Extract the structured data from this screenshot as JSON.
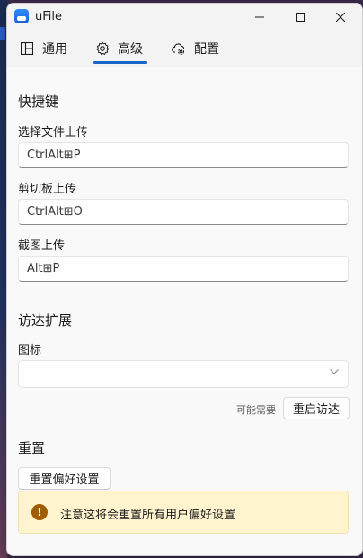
{
  "window": {
    "title": "uFile"
  },
  "nav": {
    "tabs": [
      {
        "label": "通用",
        "icon": "panel-icon",
        "selected": false
      },
      {
        "label": "高级",
        "icon": "gear-icon",
        "selected": true
      },
      {
        "label": "配置",
        "icon": "cloud-settings-icon",
        "selected": false
      }
    ],
    "info_icon": "info-icon",
    "close_icon": "close-icon"
  },
  "shortcuts": {
    "title": "快捷键",
    "select_file_upload": {
      "label": "选择文件上传",
      "value": "CtrlAlt⊞P"
    },
    "clipboard_upload": {
      "label": "剪切板上传",
      "value": "CtrlAlt⊞O"
    },
    "screenshot_upload": {
      "label": "截图上传",
      "value": "Alt⊞P"
    }
  },
  "finder_extension": {
    "title": "访达扩展",
    "icon_label": "图标",
    "icon_value": "",
    "hint": "可能需要",
    "restart_button": "重启访达"
  },
  "reset": {
    "title": "重置",
    "reset_button": "重置偏好设置",
    "warning_text": "注意这将会重置所有用户偏好设置",
    "warning_icon_glyph": "!"
  },
  "colors": {
    "accent": "#1a63c8",
    "warning_bg": "#fff4ce",
    "warning_icon": "#9d5d00"
  }
}
